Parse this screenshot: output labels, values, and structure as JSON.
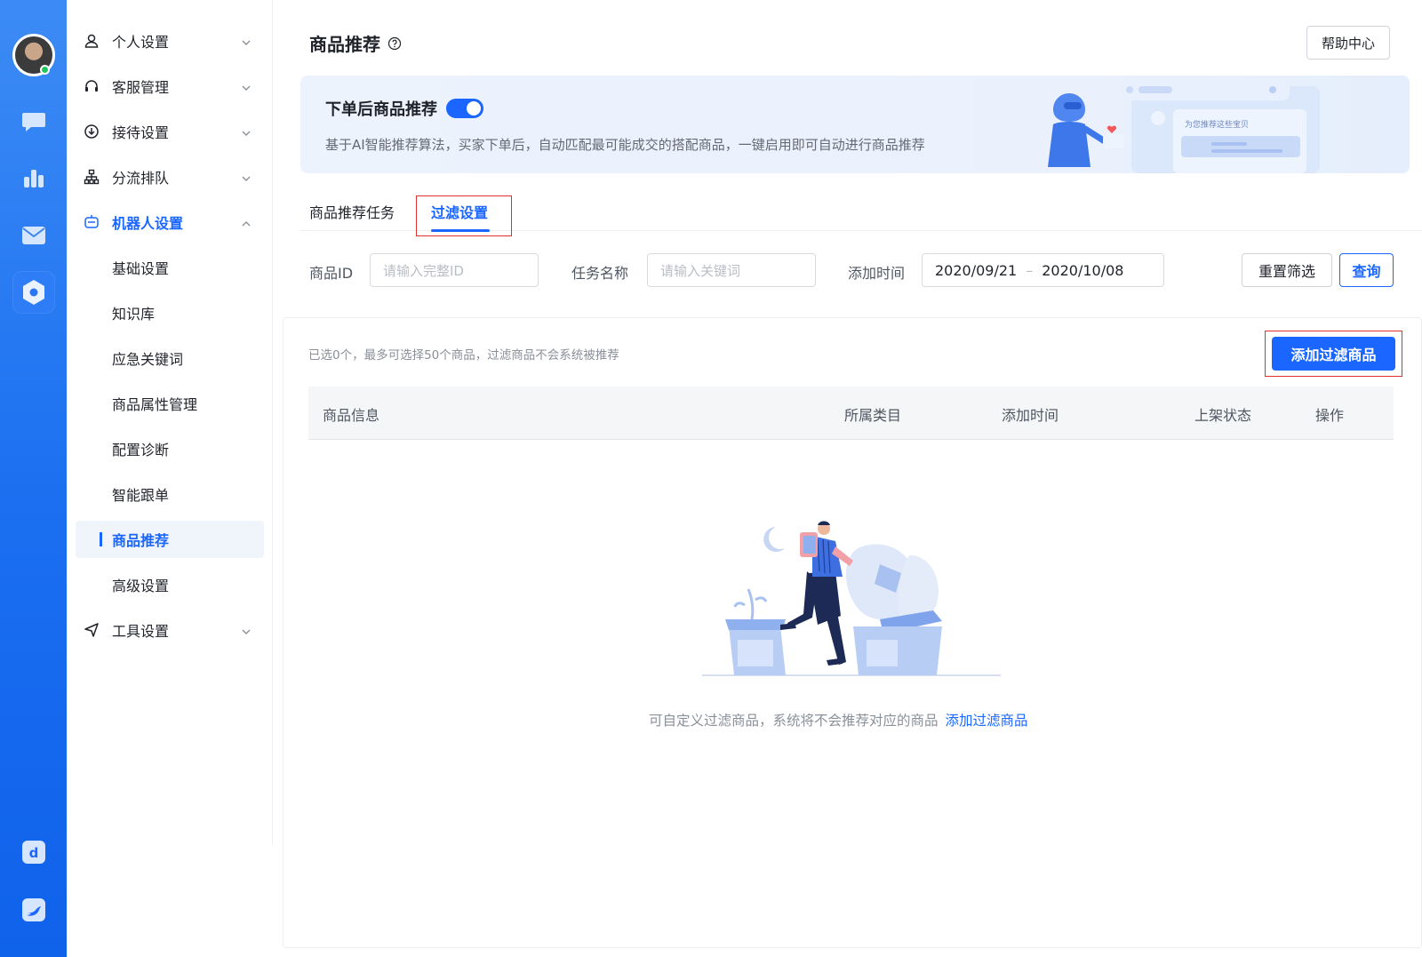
{
  "rail": {
    "icons": [
      "chat-icon",
      "chart-icon",
      "mail-icon",
      "settings-hex-icon",
      "app-icon",
      "bird-icon"
    ]
  },
  "sidebar": {
    "groups": [
      {
        "label": "个人设置",
        "icon": "user-icon"
      },
      {
        "label": "客服管理",
        "icon": "headset-icon"
      },
      {
        "label": "接待设置",
        "icon": "download-circle-icon"
      },
      {
        "label": "分流排队",
        "icon": "org-tree-icon"
      },
      {
        "label": "机器人设置",
        "icon": "robot-icon"
      }
    ],
    "sub_items": [
      "基础设置",
      "知识库",
      "应急关键词",
      "商品属性管理",
      "配置诊断",
      "智能跟单",
      "商品推荐",
      "高级设置"
    ],
    "tools": {
      "label": "工具设置",
      "icon": "send-icon"
    }
  },
  "header": {
    "title": "商品推荐",
    "help_button": "帮助中心"
  },
  "banner": {
    "title": "下单后商品推荐",
    "toggle_on": true,
    "description": "基于AI智能推荐算法，买家下单后，自动匹配最可能成交的搭配商品，一键启用即可自动进行商品推荐",
    "illustration_bubble": "为您推荐这些宝贝"
  },
  "tabs": [
    {
      "label": "商品推荐任务",
      "active": false
    },
    {
      "label": "过滤设置",
      "active": true
    }
  ],
  "filters": {
    "product_id_label": "商品ID",
    "product_id_placeholder": "请输入完整ID",
    "task_name_label": "任务名称",
    "task_name_placeholder": "请输入关键词",
    "date_label": "添加时间",
    "date_start": "2020/09/21",
    "date_sep": "–",
    "date_end": "2020/10/08",
    "reset_button": "重置筛选",
    "query_button": "查询"
  },
  "list": {
    "hint": "已选0个，最多可选择50个商品，过滤商品不会系统被推荐",
    "add_button": "添加过滤商品",
    "columns": [
      "商品信息",
      "所属类目",
      "添加时间",
      "上架状态",
      "操作"
    ],
    "rows": [],
    "empty_text": "可自定义过滤商品，系统将不会推荐对应的商品",
    "empty_link": "添加过滤商品"
  },
  "colors": {
    "primary": "#1a66ff",
    "rail_top": "#3c8bf5",
    "rail_bottom": "#0f62ea",
    "highlight_box": "#e0302e"
  }
}
